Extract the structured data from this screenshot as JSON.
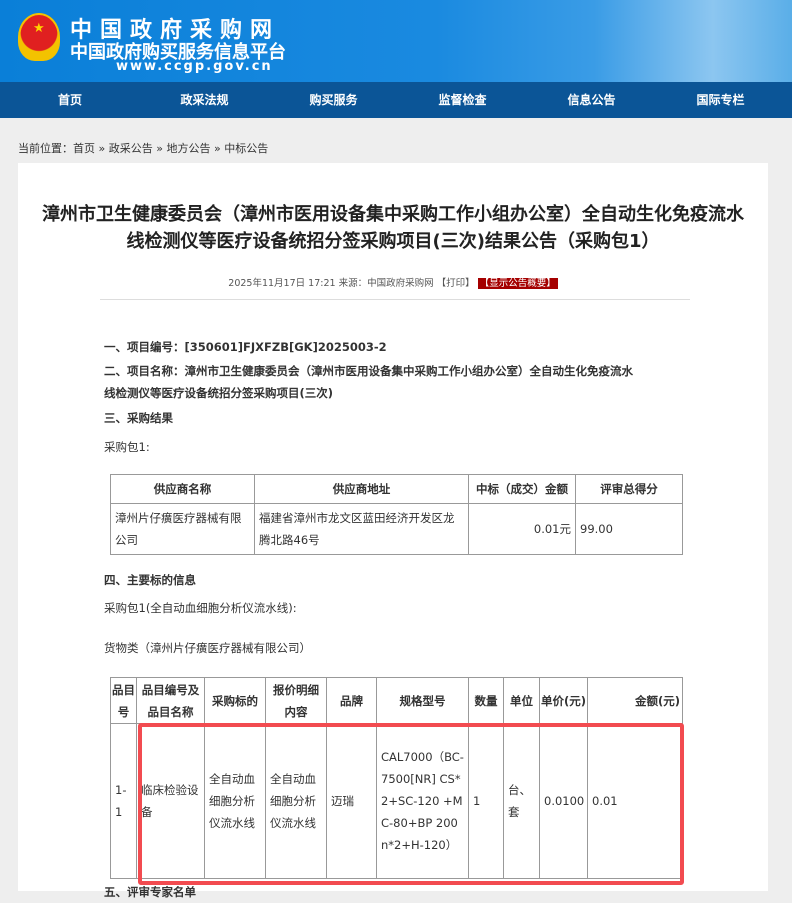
{
  "header": {
    "title": "中国政府采购网",
    "subtitle": "中国政府购买服务信息平台",
    "url": "www.ccgp.gov.cn"
  },
  "nav": [
    "首页",
    "政采法规",
    "购买服务",
    "监督检查",
    "信息公告",
    "国际专栏"
  ],
  "breadcrumb": {
    "label": "当前位置：",
    "items": [
      "首页",
      "政采公告",
      "地方公告",
      "中标公告"
    ],
    "sep": " » "
  },
  "article": {
    "title": "漳州市卫生健康委员会（漳州市医用设备集中采购工作小组办公室）全自动生化免疫流水线检测仪等医疗设备统招分签采购项目(三次)结果公告（采购包1）",
    "date": "2025年11月17日 17:21",
    "source": "来源：中国政府采购网",
    "print": "【打印】",
    "summary": "【显示公告概要】",
    "s1": "一、项目编号：[350601]FJXFZB[GK]2025003-2",
    "s2": "二、项目名称：漳州市卫生健康委员会（漳州市医用设备集中采购工作小组办公室）全自动生化免疫流水线检测仪等医疗设备统招分签采购项目(三次)",
    "s3": "三、采购结果",
    "pkg": "采购包1:",
    "t1": {
      "headers": [
        "供应商名称",
        "供应商地址",
        "中标（成交）金额",
        "评审总得分"
      ],
      "row": [
        "漳州片仔癀医疗器械有限公司",
        "福建省漳州市龙文区蓝田经济开发区龙腾北路46号",
        "0.01元",
        "99.00"
      ]
    },
    "s4": "四、主要标的信息",
    "pkg2": "采购包1(全自动血细胞分析仪流水线):",
    "goods": "货物类（漳州片仔癀医疗器械有限公司）",
    "t2": {
      "headers": [
        "品目号",
        "品目编号及品目名称",
        "采购标的",
        "报价明细内容",
        "品牌",
        "规格型号",
        "数量",
        "单位",
        "单价(元)",
        "金额(元)"
      ],
      "row": [
        "1-1",
        "临床检验设备",
        "全自动血细胞分析仪流水线",
        "全自动血细胞分析仪流水线",
        "迈瑞",
        "CAL7000（BC-7500[NR] CS*2+SC-120 +MC-80+BP 200n*2+H-120）",
        "1",
        "台、套",
        "0.0100",
        "0.01"
      ]
    },
    "s5": "五、评审专家名单"
  },
  "colors": {
    "nav": "#0b5597",
    "highlight": "#f24b50",
    "summary_bg": "#a50000"
  }
}
